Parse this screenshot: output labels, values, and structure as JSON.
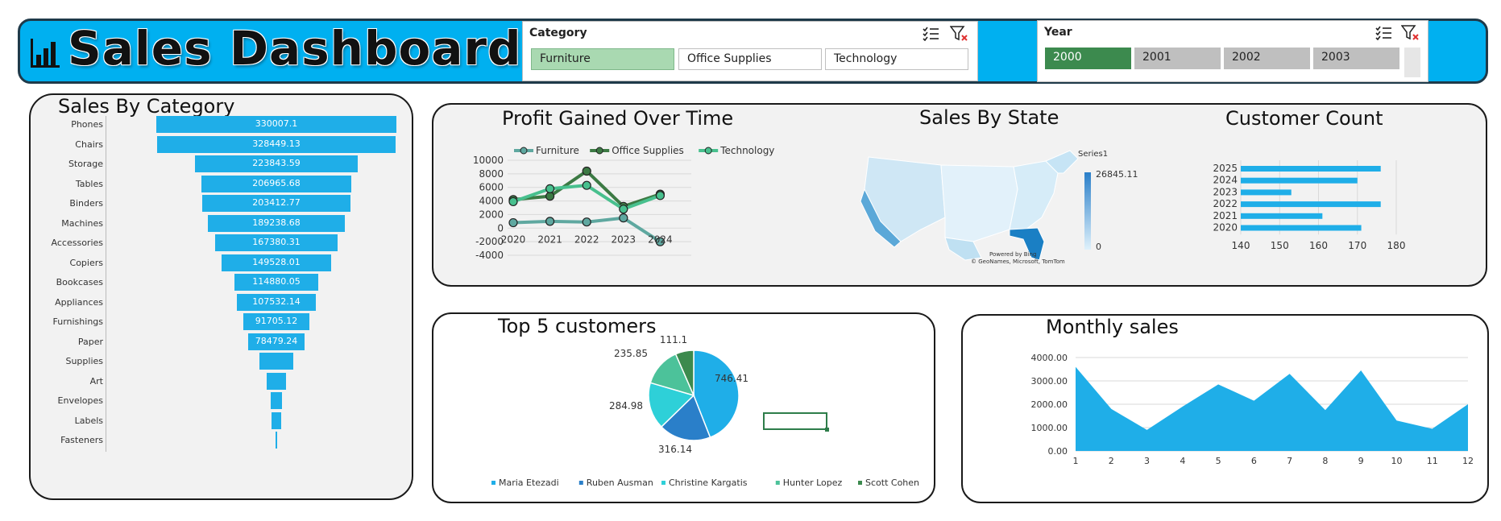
{
  "header": {
    "title": "Sales Dashboard"
  },
  "slicers": {
    "category": {
      "title": "Category",
      "items": [
        "Furniture",
        "Office Supplies",
        "Technology"
      ],
      "selected": "Furniture"
    },
    "year": {
      "title": "Year",
      "items": [
        "2000",
        "2001",
        "2002",
        "2003"
      ],
      "selected": "2000"
    }
  },
  "colors": {
    "header_bg": "#00B0F0",
    "bar": "#1FAEE8",
    "selected_category": "#A9D9B1",
    "selected_year": "#3C8A4E",
    "unselected_year": "#BFBFBF"
  },
  "panels": {
    "sales_by_category": {
      "title": "Sales By Category"
    },
    "profit": {
      "title": "Profit Gained Over Time"
    },
    "state": {
      "title": "Sales By State",
      "series_label": "Series1",
      "max": "26845.11",
      "min": "0",
      "credit_1": "Powered by Bing",
      "credit_2": "© GeoNames, Microsoft, TomTom"
    },
    "customer_count": {
      "title": "Customer Count"
    },
    "top5": {
      "title": "Top 5 customers"
    },
    "monthly": {
      "title": "Monthly sales"
    }
  },
  "chart_data": [
    {
      "type": "bar",
      "title": "Sales By Category",
      "categories": [
        "Phones",
        "Chairs",
        "Storage",
        "Tables",
        "Binders",
        "Machines",
        "Accessories",
        "Copiers",
        "Bookcases",
        "Appliances",
        "Furnishings",
        "Paper",
        "Supplies",
        "Art",
        "Envelopes",
        "Labels",
        "Fasteners"
      ],
      "values": [
        330007.1,
        328449.13,
        223843.59,
        206965.68,
        203412.77,
        189238.68,
        167380.31,
        149528.01,
        114880.05,
        107532.14,
        91705.12,
        78479.24,
        46673.54,
        27118.79,
        16476.4,
        12486.31,
        3024.28
      ],
      "labels": [
        "330007.1",
        "328449.13",
        "223843.59",
        "206965.68",
        "203412.77",
        "189238.68",
        "167380.31",
        "149528.01",
        "114880.05",
        "107532.14",
        "91705.12",
        "78479.24",
        "",
        "",
        "",
        "",
        ""
      ]
    },
    {
      "type": "line",
      "title": "Profit Gained Over Time",
      "categories": [
        "2020",
        "2021",
        "2022",
        "2023",
        "2024"
      ],
      "series": [
        {
          "name": "Furniture",
          "values": [
            800,
            1000,
            900,
            1500,
            -2000
          ],
          "color": "#5FA8A0"
        },
        {
          "name": "Office Supplies",
          "values": [
            4200,
            4700,
            8400,
            3200,
            5000
          ],
          "color": "#3C7A44"
        },
        {
          "name": "Technology",
          "values": [
            3900,
            5800,
            6300,
            2800,
            4800
          ],
          "color": "#48C08E"
        }
      ],
      "yticks": [
        "10000",
        "8000",
        "6000",
        "4000",
        "2000",
        "0",
        "-2000",
        "-4000"
      ],
      "ylim": [
        -4000,
        10000
      ]
    },
    {
      "type": "bar",
      "title": "Customer Count",
      "orientation": "horizontal",
      "categories": [
        "2025",
        "2024",
        "2023",
        "2022",
        "2021",
        "2020"
      ],
      "values": [
        176,
        170,
        153,
        176,
        161,
        171
      ],
      "xticks": [
        "140",
        "150",
        "160",
        "170",
        "180"
      ],
      "xlim": [
        140,
        180
      ]
    },
    {
      "type": "pie",
      "title": "Top 5 customers",
      "categories": [
        "Maria Etezadi",
        "Ruben Ausman",
        "Christine Kargatis",
        "Hunter Lopez",
        "Scott Cohen"
      ],
      "values": [
        746.41,
        316.14,
        284.98,
        235.85,
        111.1
      ],
      "labels": [
        "746.41",
        "316.14",
        "284.98",
        "235.85",
        "111.1"
      ],
      "colors": [
        "#1FAEE8",
        "#2A7FC9",
        "#2ED0D8",
        "#4CC29A",
        "#3C8A4E"
      ]
    },
    {
      "type": "area",
      "title": "Monthly sales",
      "x": [
        "1",
        "2",
        "3",
        "4",
        "5",
        "6",
        "7",
        "8",
        "9",
        "10",
        "11",
        "12"
      ],
      "values": [
        3600,
        1800,
        900,
        1900,
        2850,
        2150,
        3300,
        1750,
        3450,
        1300,
        950,
        2000
      ],
      "yticks": [
        "4000.00",
        "3000.00",
        "2000.00",
        "1000.00",
        "0.00"
      ],
      "ylim": [
        0,
        4000
      ]
    }
  ]
}
